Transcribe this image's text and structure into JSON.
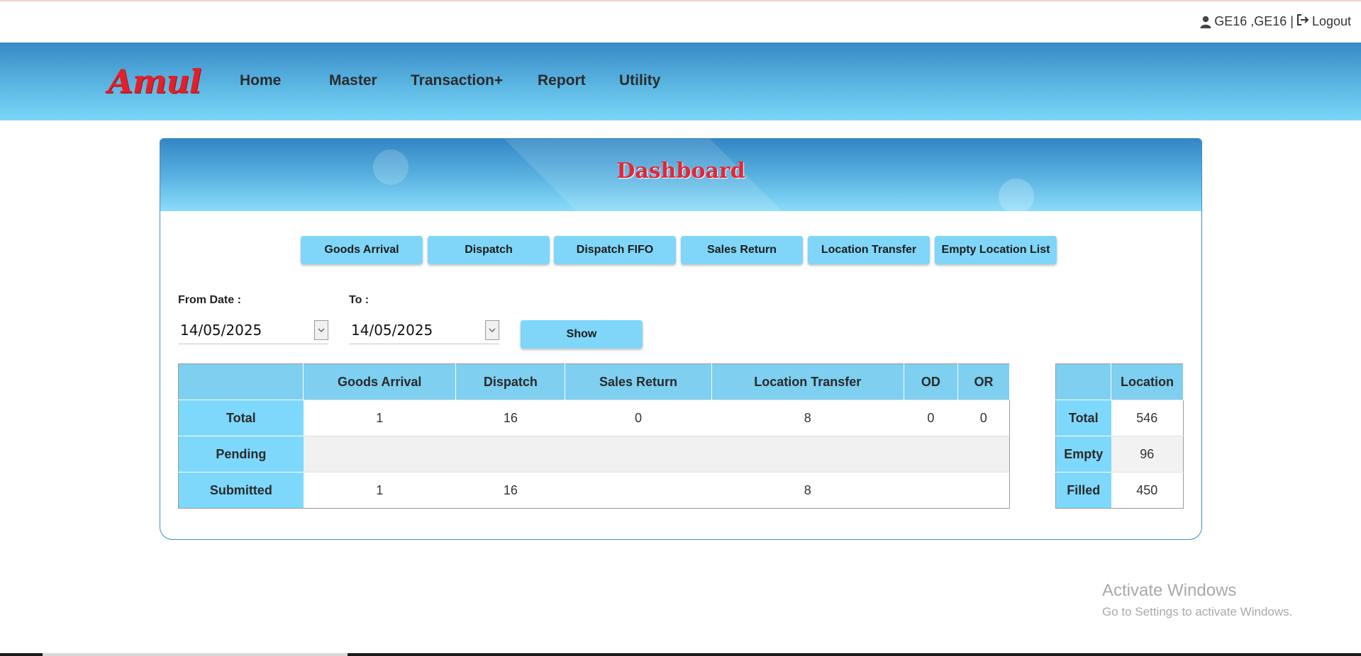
{
  "user": {
    "name": "GE16 ,GE16 |",
    "logout_label": "Logout"
  },
  "brand": {
    "logo_text": "Amul",
    "logo_color": "#e3202a"
  },
  "nav": {
    "items": [
      {
        "label": "Home"
      },
      {
        "label": "Master"
      },
      {
        "label": "Transaction+"
      },
      {
        "label": "Report"
      },
      {
        "label": "Utility"
      }
    ]
  },
  "dashboard": {
    "title": "Dashboard",
    "tabs": [
      {
        "label": "Goods Arrival"
      },
      {
        "label": "Dispatch"
      },
      {
        "label": "Dispatch FIFO"
      },
      {
        "label": "Sales Return"
      },
      {
        "label": "Location Transfer"
      },
      {
        "label": "Empty Location List"
      }
    ],
    "filters": {
      "from_label": "From Date :",
      "from_value": "14/05/2025",
      "to_label": "To :",
      "to_value": "14/05/2025",
      "show_label": "Show"
    },
    "summary_table": {
      "columns": [
        "",
        "Goods Arrival",
        "Dispatch",
        "Sales Return",
        "Location Transfer",
        "OD",
        "OR"
      ],
      "rows": [
        {
          "label": "Total",
          "cells": [
            "1",
            "16",
            "0",
            "8",
            "0",
            "0"
          ]
        },
        {
          "label": "Pending",
          "cells": [
            "",
            "",
            "",
            "",
            "",
            ""
          ]
        },
        {
          "label": "Submitted",
          "cells": [
            "1",
            "16",
            "",
            "8",
            "",
            ""
          ]
        }
      ]
    },
    "location_table": {
      "columns": [
        "",
        "Location"
      ],
      "rows": [
        {
          "label": "Total",
          "value": "546"
        },
        {
          "label": "Empty",
          "value": "96"
        },
        {
          "label": "Filled",
          "value": "450"
        }
      ]
    }
  },
  "watermark": {
    "title": "Activate Windows",
    "subtitle": "Go to Settings to activate Windows."
  },
  "colors": {
    "accent": "#7fd6f8",
    "header_dark": "#3789c5",
    "title_red": "#e42634"
  }
}
